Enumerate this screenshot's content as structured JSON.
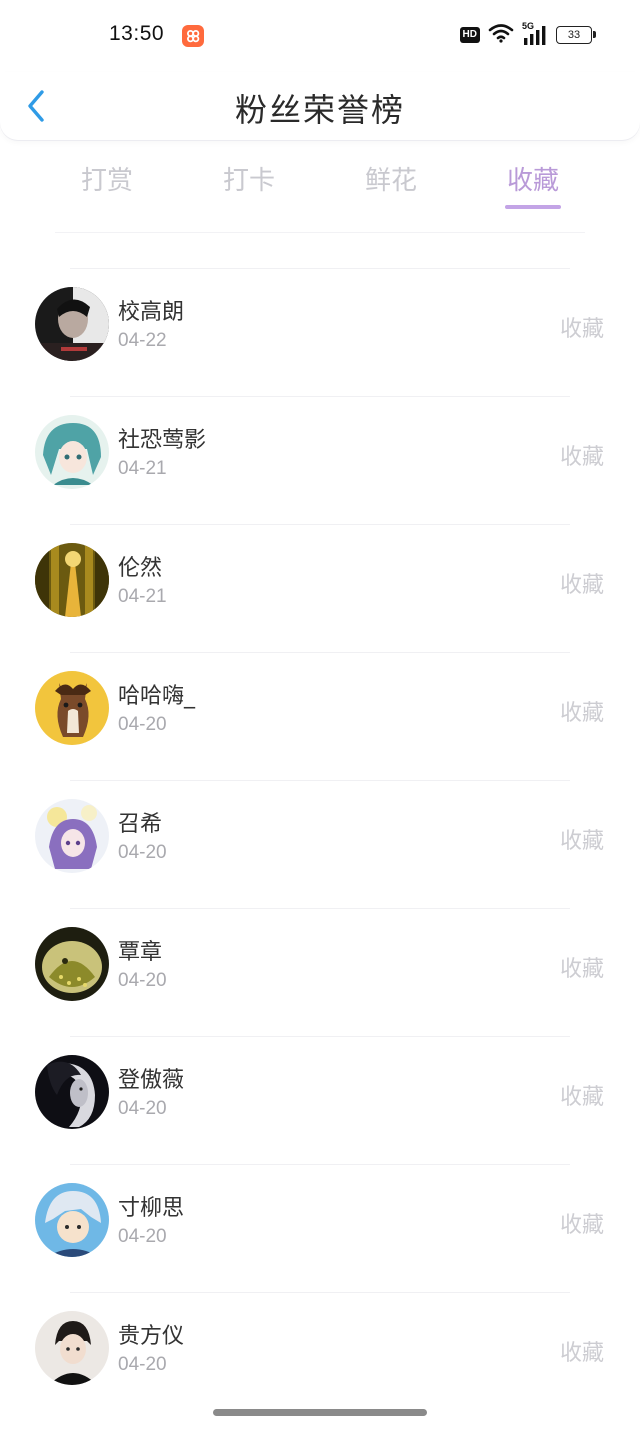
{
  "status_bar": {
    "time": "13:50",
    "hd_label": "HD",
    "network_label": "5G",
    "battery_level": "33"
  },
  "header": {
    "title": "粉丝荣誉榜"
  },
  "tabs": [
    {
      "label": "打赏",
      "active": false
    },
    {
      "label": "打卡",
      "active": false
    },
    {
      "label": "鲜花",
      "active": false
    },
    {
      "label": "收藏",
      "active": true
    }
  ],
  "colors": {
    "accent": "#c3a4e6",
    "tab_inactive": "#c9c9cf",
    "date_text": "#a9a9ae",
    "action_text": "#cdcdd2",
    "back_icon": "#2f9be6"
  },
  "fans": [
    {
      "name": "校高朗",
      "date": "04-22",
      "action": "收藏"
    },
    {
      "name": "社恐莺影",
      "date": "04-21",
      "action": "收藏"
    },
    {
      "name": "伦然",
      "date": "04-21",
      "action": "收藏"
    },
    {
      "name": "哈哈嗨_",
      "date": "04-20",
      "action": "收藏"
    },
    {
      "name": "召希",
      "date": "04-20",
      "action": "收藏"
    },
    {
      "name": "覃章",
      "date": "04-20",
      "action": "收藏"
    },
    {
      "name": "登傲薇",
      "date": "04-20",
      "action": "收藏"
    },
    {
      "name": "寸柳思",
      "date": "04-20",
      "action": "收藏"
    },
    {
      "name": "贵方仪",
      "date": "04-20",
      "action": "收藏"
    }
  ]
}
